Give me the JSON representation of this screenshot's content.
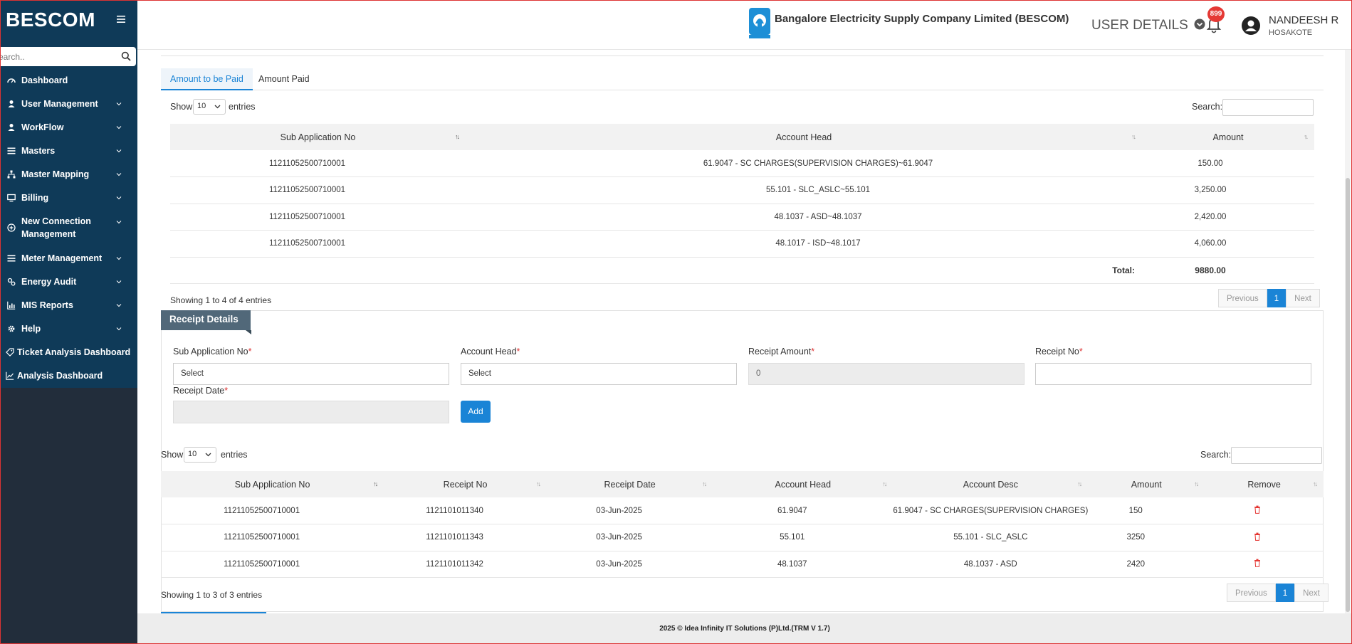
{
  "sidebar": {
    "brand": "BESCOM",
    "search_placeholder": "Search..",
    "items": [
      {
        "label": "Dashboard",
        "icon": "dashboard-icon"
      },
      {
        "label": "User Management",
        "icon": "user-icon"
      },
      {
        "label": "WorkFlow",
        "icon": "user-icon"
      },
      {
        "label": "Masters",
        "icon": "list-icon"
      },
      {
        "label": "Master Mapping",
        "icon": "sitemap-icon"
      },
      {
        "label": "Billing",
        "icon": "monitor-icon"
      },
      {
        "label": "New Connection Management",
        "icon": "plus-circle-icon"
      },
      {
        "label": "Meter Management",
        "icon": "list-icon"
      },
      {
        "label": "Energy Audit",
        "icon": "cogs-icon"
      },
      {
        "label": "MIS Reports",
        "icon": "bar-chart-icon"
      },
      {
        "label": "Help",
        "icon": "gear-icon"
      },
      {
        "label": "Ticket Analysis Dashboard",
        "icon": "tag-icon"
      },
      {
        "label": "Analysis Dashboard",
        "icon": "line-chart-icon"
      }
    ]
  },
  "header": {
    "company": "Bangalore Electricity Supply Company Limited (BESCOM)",
    "user_details": "USER DETAILS",
    "notifications": "899",
    "user_name": "NANDEESH R",
    "user_location": "HOSAKOTE"
  },
  "tabs": [
    "Amount to be Paid",
    "Amount Paid"
  ],
  "datatable": {
    "show": "Show",
    "entries": "entries",
    "page_size": "10",
    "search": "Search:",
    "previous": "Previous",
    "next": "Next",
    "page": "1"
  },
  "amount_table": {
    "columns": [
      "Sub Application No",
      "Account Head",
      "Amount"
    ],
    "rows": [
      [
        "11211052500710001",
        "61.9047 - SC CHARGES(SUPERVISION CHARGES)~61.9047",
        "150.00"
      ],
      [
        "11211052500710001",
        "55.101 - SLC_ASLC~55.101",
        "3,250.00"
      ],
      [
        "11211052500710001",
        "48.1037 - ASD~48.1037",
        "2,420.00"
      ],
      [
        "11211052500710001",
        "48.1017 - ISD~48.1017",
        "4,060.00"
      ]
    ],
    "total_label": "Total:",
    "total_value": "9880.00",
    "info": "Showing 1 to 4 of 4 entries"
  },
  "receipt": {
    "title": "Receipt Details",
    "fields": {
      "sub_app_label": "Sub Application No",
      "sub_app_value": "Select",
      "account_head_label": "Account Head",
      "account_head_value": "Select",
      "receipt_amount_label": "Receipt Amount",
      "receipt_amount_value": "0",
      "receipt_no_label": "Receipt No",
      "receipt_date_label": "Receipt Date",
      "required_mark": "*"
    },
    "add_label": "Add"
  },
  "receipt_table": {
    "columns": [
      "Sub Application No",
      "Receipt No",
      "Receipt Date",
      "Account Head",
      "Account Desc",
      "Amount",
      "Remove"
    ],
    "rows": [
      [
        "11211052500710001",
        "1121101011340",
        "03-Jun-2025",
        "61.9047",
        "61.9047 - SC CHARGES(SUPERVISION CHARGES)",
        "150"
      ],
      [
        "11211052500710001",
        "1121101011343",
        "03-Jun-2025",
        "55.101",
        "55.101 - SLC_ASLC",
        "3250"
      ],
      [
        "11211052500710001",
        "1121101011342",
        "03-Jun-2025",
        "48.1037",
        "48.1037 - ASD",
        "2420"
      ]
    ],
    "info": "Showing 1 to 3 of 3 entries"
  },
  "footer": "2025 © Idea Infinity IT Solutions (P)Ltd.(TRM V 1.7)",
  "colors": {
    "sidebar": "#0f3a58",
    "accent": "#1a84d6",
    "danger": "#e53935",
    "section_title": "#516879"
  }
}
